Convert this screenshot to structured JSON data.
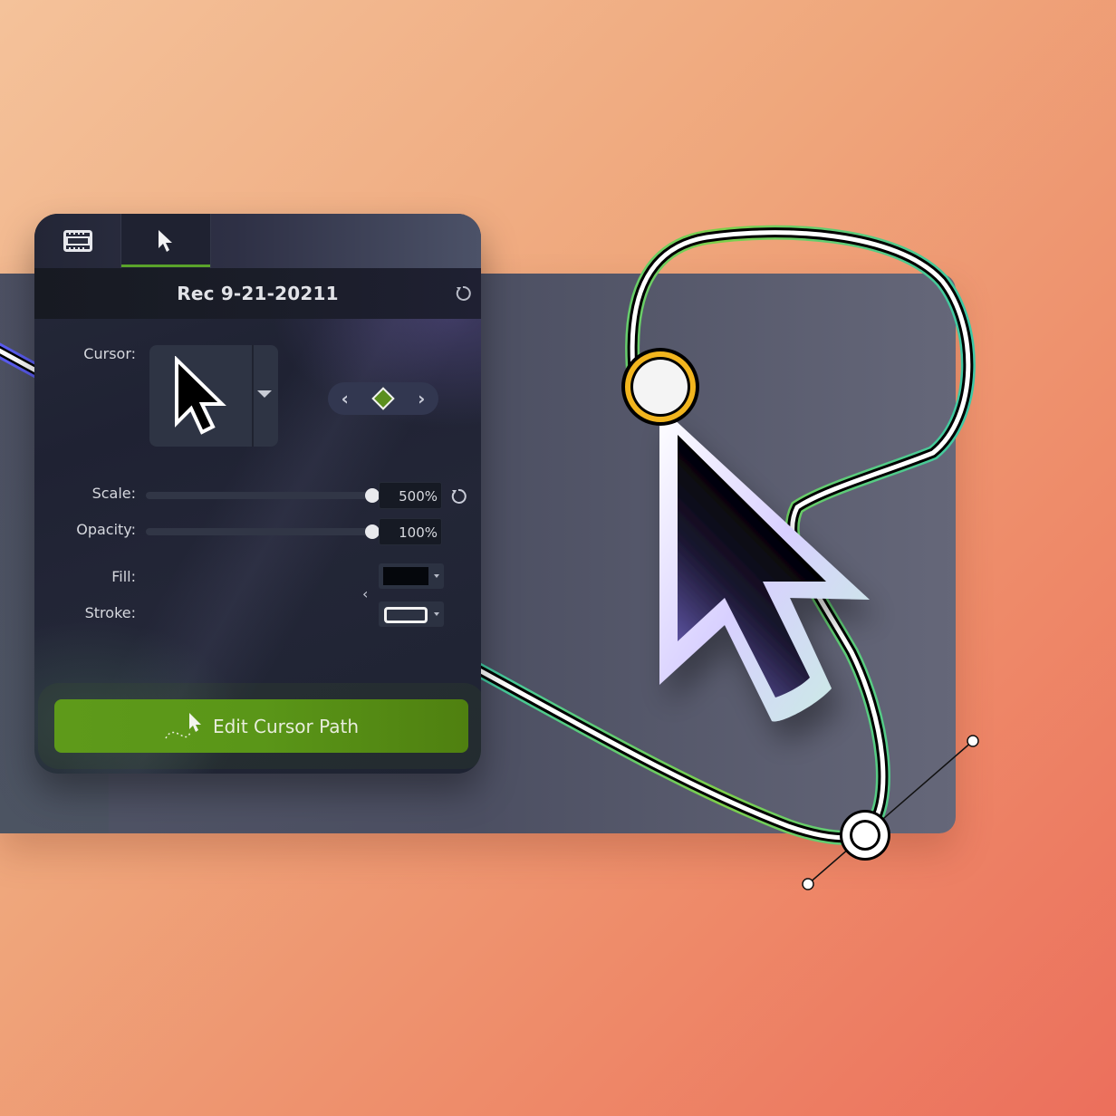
{
  "panel": {
    "tabs": [
      {
        "name": "media",
        "icon": "film-strip-icon",
        "active": false
      },
      {
        "name": "cursor",
        "icon": "cursor-arrow-icon",
        "active": true
      }
    ],
    "title": "Rec 9-21-20211",
    "cursor_label": "Cursor:",
    "scale_label": "Scale:",
    "scale_value": "500%",
    "scale_fraction": 1.0,
    "opacity_label": "Opacity:",
    "opacity_value": "100%",
    "opacity_fraction": 1.0,
    "fill_label": "Fill:",
    "fill_color": "#05070c",
    "stroke_label": "Stroke:",
    "stroke_color": "#f2f2f2",
    "keyframe_prev": "‹",
    "keyframe_next": "›",
    "edit_button_label": "Edit Cursor Path"
  },
  "colors": {
    "accent_green": "#5a9618",
    "keyframe_ring": "#f2b51e",
    "path_outer_green": "#7ed04a",
    "path_outer_teal": "#3ec9a6",
    "path_outer_blue": "#5a5cf0"
  }
}
